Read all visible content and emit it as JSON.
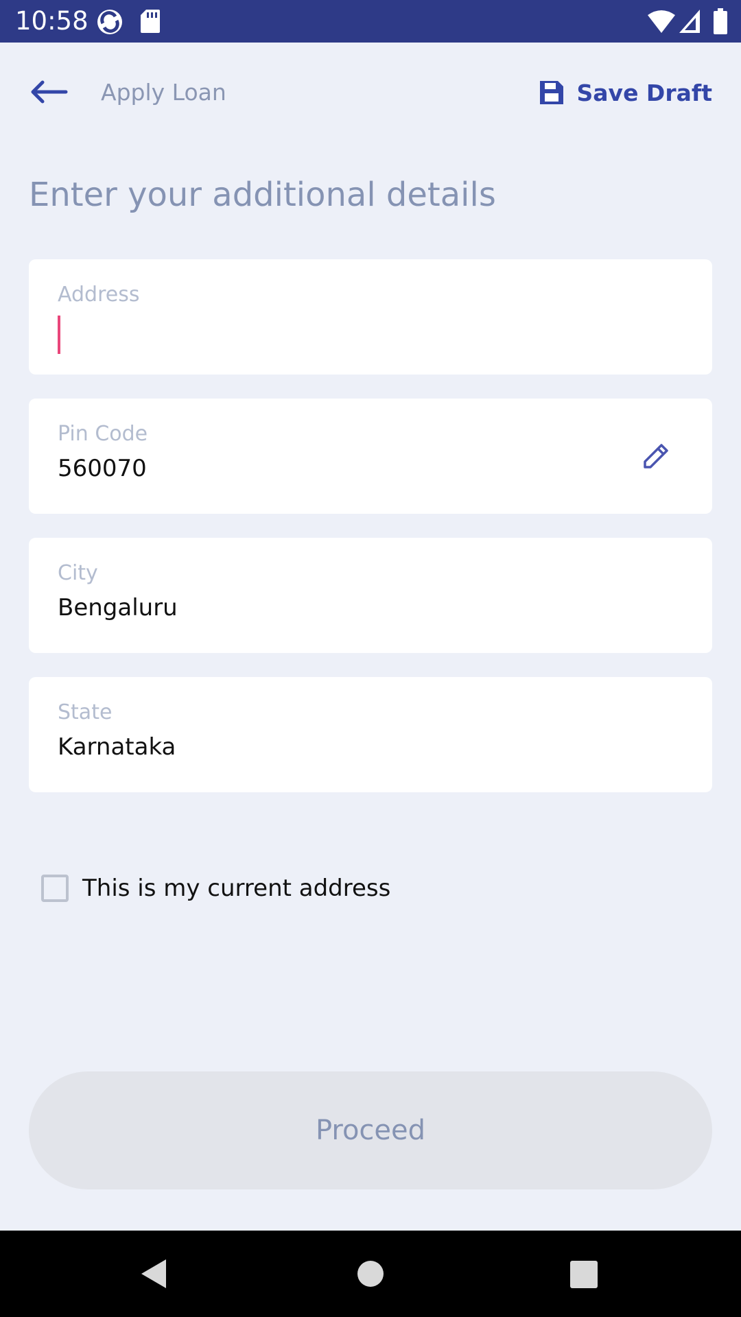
{
  "status_bar": {
    "time": "10:58",
    "left_icons": [
      "sync-app-icon",
      "sd-card-icon"
    ],
    "right_icons": [
      "wifi-icon",
      "cell-signal-icon",
      "battery-icon"
    ],
    "background_color": "#2e3a87"
  },
  "header": {
    "back_icon": "arrow-left-icon",
    "title": "Apply Loan",
    "save_draft_icon": "floppy-disk-icon",
    "save_draft_label": "Save Draft",
    "accent_color": "#3346a8"
  },
  "heading": "Enter your additional details",
  "form": {
    "address": {
      "label": "Address",
      "value": "",
      "focused": true
    },
    "pin_code": {
      "label": "Pin Code",
      "value": "560070",
      "action_icon": "pencil-edit-icon"
    },
    "city": {
      "label": "City",
      "value": "Bengaluru"
    },
    "state": {
      "label": "State",
      "value": "Karnataka"
    }
  },
  "current_address_checkbox": {
    "label": "This is my current address",
    "checked": false
  },
  "proceed_button": {
    "label": "Proceed",
    "enabled": false
  },
  "nav_bar": {
    "buttons": [
      "back-triangle-icon",
      "home-circle-icon",
      "recents-square-icon"
    ]
  }
}
